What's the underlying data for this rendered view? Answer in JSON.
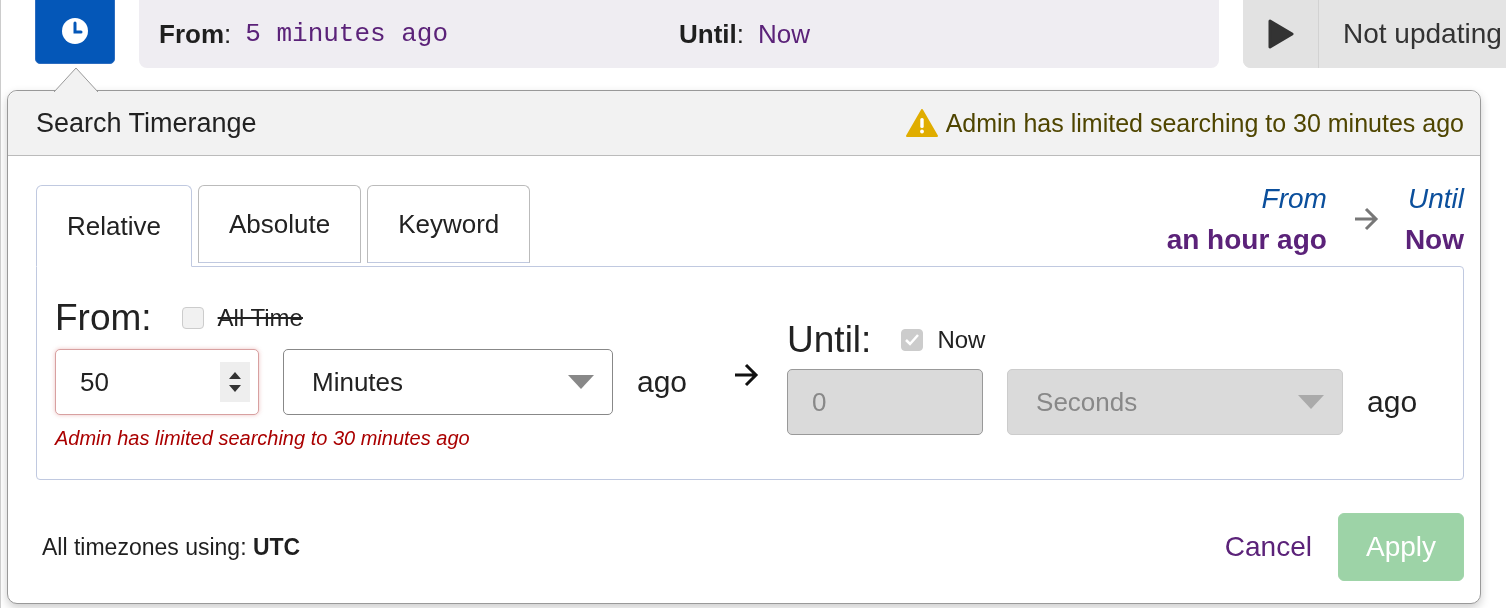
{
  "toolbar": {
    "from_label": "**From**:",
    "from_value": "5 minutes ago",
    "until_label": "**Until**:",
    "until_value": "Now",
    "status": "Not updating"
  },
  "popover": {
    "title": "Search Timerange",
    "warning": "Admin has limited searching to 30 minutes ago",
    "tabs": [
      {
        "label": "Relative",
        "selected": true
      },
      {
        "label": "Absolute",
        "selected": false
      },
      {
        "label": "Keyword",
        "selected": false
      }
    ],
    "summary": {
      "from_label": "From",
      "from_value": "an hour ago",
      "until_label": "Until",
      "until_value": "Now"
    },
    "from": {
      "label": "From:",
      "all_time": {
        "label": "All Time",
        "checked": false,
        "disabled": true
      },
      "value": "50",
      "unit": "Minutes",
      "suffix": "ago",
      "error": "Admin has limited searching to 30 minutes ago"
    },
    "until": {
      "label": "Until:",
      "now": {
        "label": "Now",
        "checked": true
      },
      "value": "0",
      "unit": "Seconds",
      "suffix": "ago"
    },
    "footer": {
      "timezone_label": "All timezones using:",
      "timezone": "UTC"
    },
    "cancel": {
      "label": "Cancel"
    },
    "apply": {
      "label": "Apply",
      "disabled": true
    }
  }
}
